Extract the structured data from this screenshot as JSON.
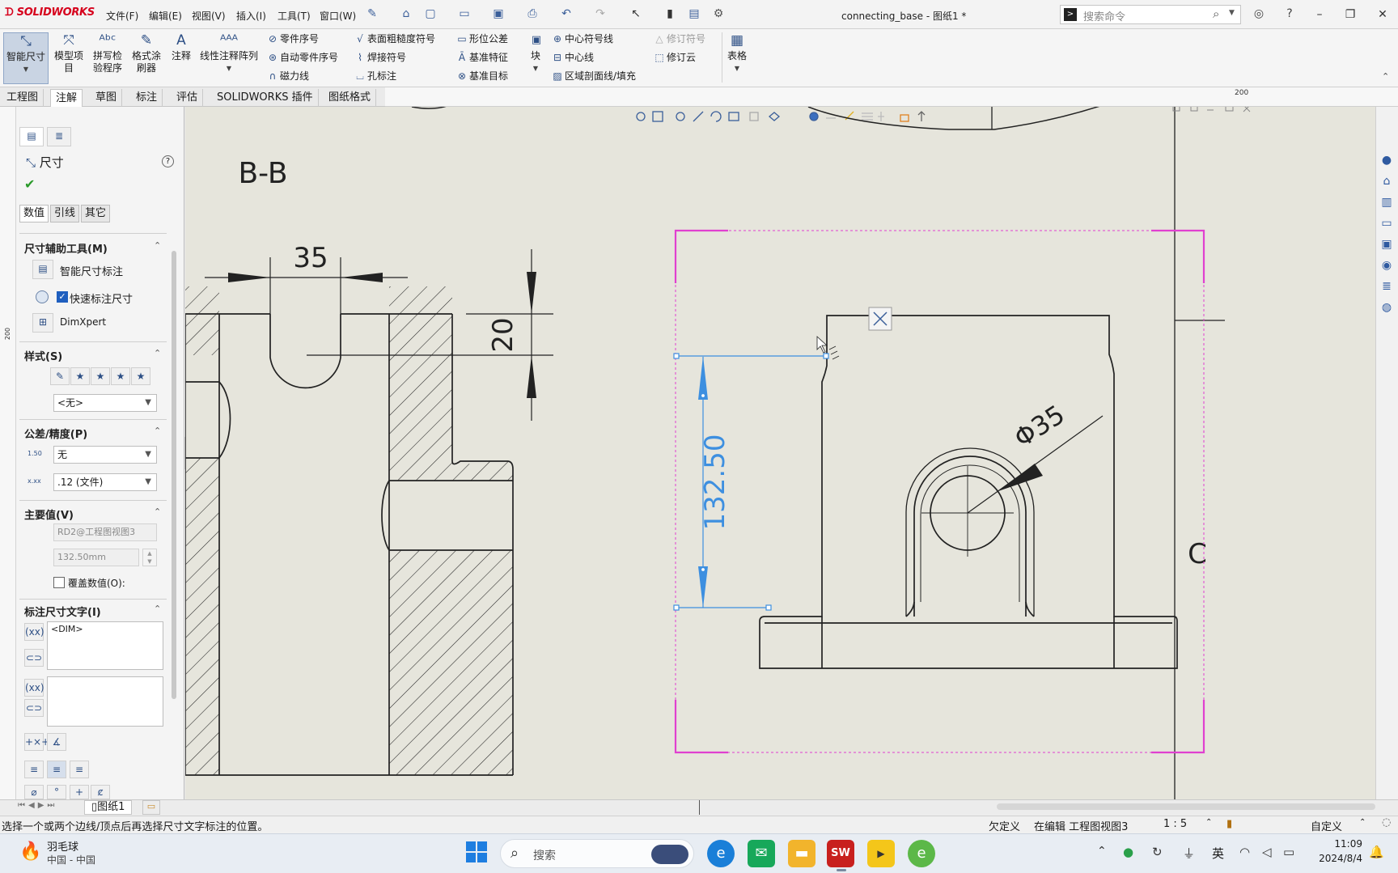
{
  "app": {
    "logo": "SOLIDWORKS",
    "menus": [
      "文件(F)",
      "编辑(E)",
      "视图(V)",
      "插入(I)",
      "工具(T)",
      "窗口(W)"
    ],
    "document_title": "connecting_base - 图纸1 *",
    "search_placeholder": "搜索命令"
  },
  "ribbon": {
    "big_buttons": [
      "智能尺寸",
      "模型项目",
      "拼写检验程序",
      "格式涂刷器",
      "注释",
      "线性注释阵列"
    ],
    "col1": [
      "零件序号",
      "自动零件序号",
      "磁力线"
    ],
    "col2": [
      "表面粗糙度符号",
      "焊接符号",
      "孔标注"
    ],
    "col3": [
      "形位公差",
      "基准特征",
      "基准目标"
    ],
    "block_label": "块",
    "col4": [
      "中心符号线",
      "中心线",
      "区域剖面线/填充"
    ],
    "col5": [
      "修订符号",
      "修订云"
    ],
    "table_label": "表格"
  },
  "tabs": [
    "工程图",
    "注解",
    "草图",
    "标注",
    "评估",
    "SOLIDWORKS 插件",
    "图纸格式"
  ],
  "active_tab": 1,
  "ruler": {
    "top_mark": "200",
    "left_mark": "200"
  },
  "property_manager": {
    "title": "尺寸",
    "subtabs": [
      "数值",
      "引线",
      "其它"
    ],
    "sections": {
      "dim_assist": {
        "title": "尺寸辅助工具(M)",
        "smart_dim": "智能尺寸标注",
        "quick_dim": "快速标注尺寸",
        "quick_dim_checked": true,
        "dimxpert": "DimXpert"
      },
      "style": {
        "title": "样式(S)",
        "value": "<无>"
      },
      "tolerance": {
        "title": "公差/精度(P)",
        "tolerance_value": "无",
        "precision_value": ".12 (文件)",
        "tol_icon": "1.50",
        "prec_icon": "x.xx"
      },
      "primary": {
        "title": "主要值(V)",
        "name": "RD2@工程图视图3",
        "value": "132.50mm",
        "override": "覆盖数值(O):",
        "override_checked": false
      },
      "dim_text": {
        "title": "标注尺寸文字(I)",
        "dim_placeholder": "<DIM>"
      }
    }
  },
  "drawing": {
    "section_label": "B-B",
    "dim_35_linear": "35",
    "dim_20": "20",
    "dim_diameter": "Φ35",
    "dim_active": "132.50",
    "zone_letter": "C"
  },
  "sheet_tab": "图纸1",
  "status": {
    "message": "选择一个或两个边线/顶点后再选择尺寸文字标注的位置。",
    "defined": "欠定义",
    "editing": "在编辑 工程图视图3",
    "scale": "1 : 5",
    "units": "自定义"
  },
  "taskbar": {
    "weather_title": "羽毛球",
    "weather_sub": "中国 - 中国",
    "search_label": "搜索",
    "lang": "英",
    "time": "11:09",
    "date": "2024/8/4"
  },
  "colors": {
    "canvas_bg": "#e6e5dc",
    "selection_magenta": "#e040d0",
    "active_dim_blue": "#3d8fe0",
    "logo_red": "#d6001c"
  }
}
